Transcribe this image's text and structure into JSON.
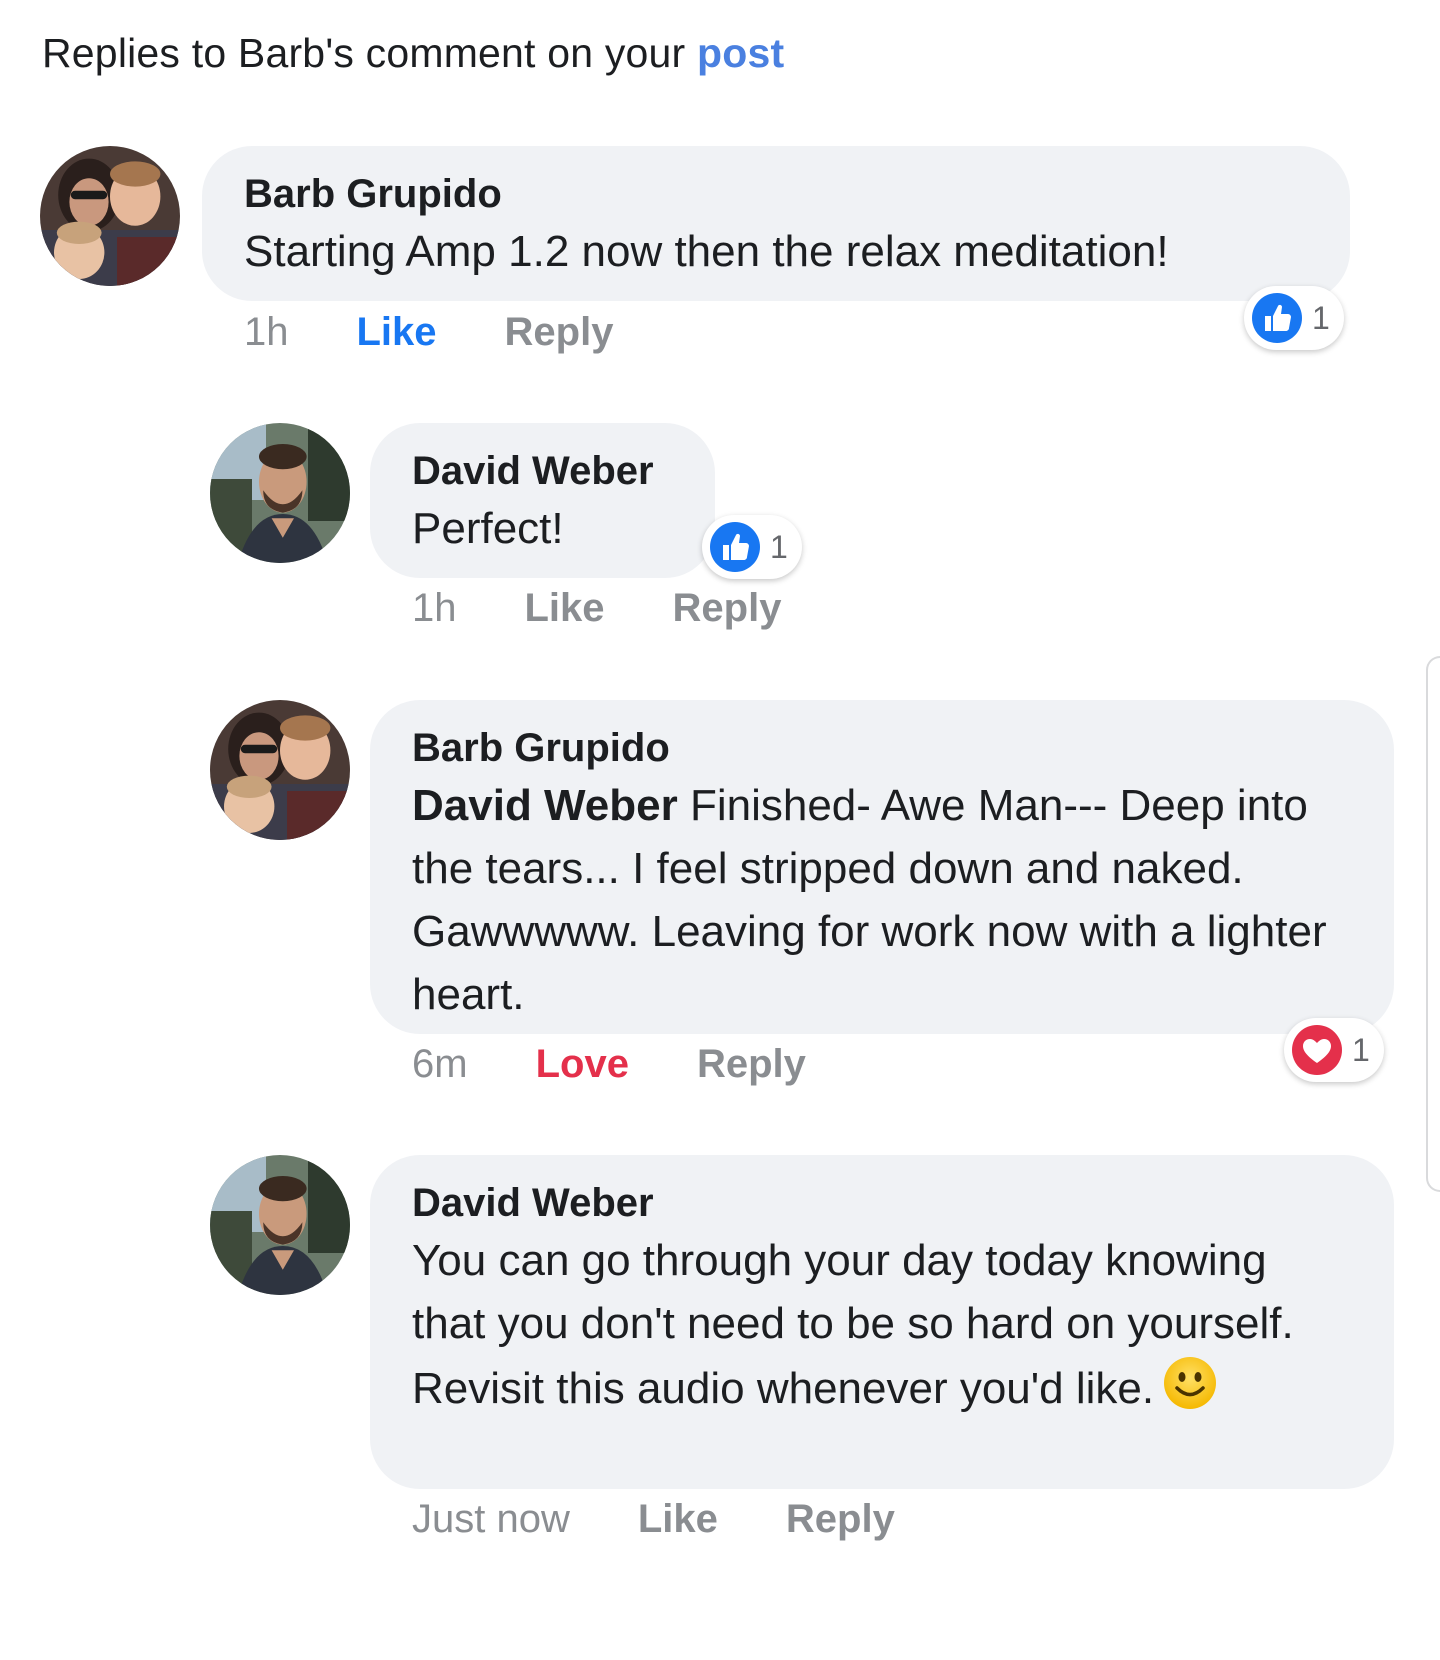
{
  "header": {
    "prefix": "Replies to Barb's comment on your ",
    "link": "post"
  },
  "colors": {
    "bubble": "#f0f2f5",
    "link_blue": "#4a80e0",
    "like_blue": "#1877f2",
    "love_red": "#e4304b",
    "muted": "#8a8d91"
  },
  "comments": [
    {
      "author": "Barb Grupido",
      "text": "Starting Amp 1.2 now then the relax meditation!",
      "time": "1h",
      "like_label": "Like",
      "reply_label": "Reply",
      "reaction": {
        "icon": "like-icon",
        "count": "1"
      }
    },
    {
      "author": "David Weber",
      "text": "Perfect!",
      "time": "1h",
      "like_label": "Like",
      "reply_label": "Reply",
      "reaction": {
        "icon": "like-icon",
        "count": "1"
      }
    },
    {
      "author": "Barb Grupido",
      "mention": "David Weber",
      "text": " Finished-  Awe Man--- Deep into the tears... I feel stripped down and naked. Gawwwww. Leaving for work now with a lighter heart.",
      "time": "6m",
      "like_label": "Love",
      "reply_label": "Reply",
      "reaction": {
        "icon": "love-icon",
        "count": "1"
      }
    },
    {
      "author": "David Weber",
      "text": "You can go through your day today knowing that you don't need to be so hard on yourself.  Revisit this audio whenever you'd like.",
      "emoji": "smiley-emoji-icon",
      "time": "Just now",
      "like_label": "Like",
      "reply_label": "Reply"
    }
  ]
}
